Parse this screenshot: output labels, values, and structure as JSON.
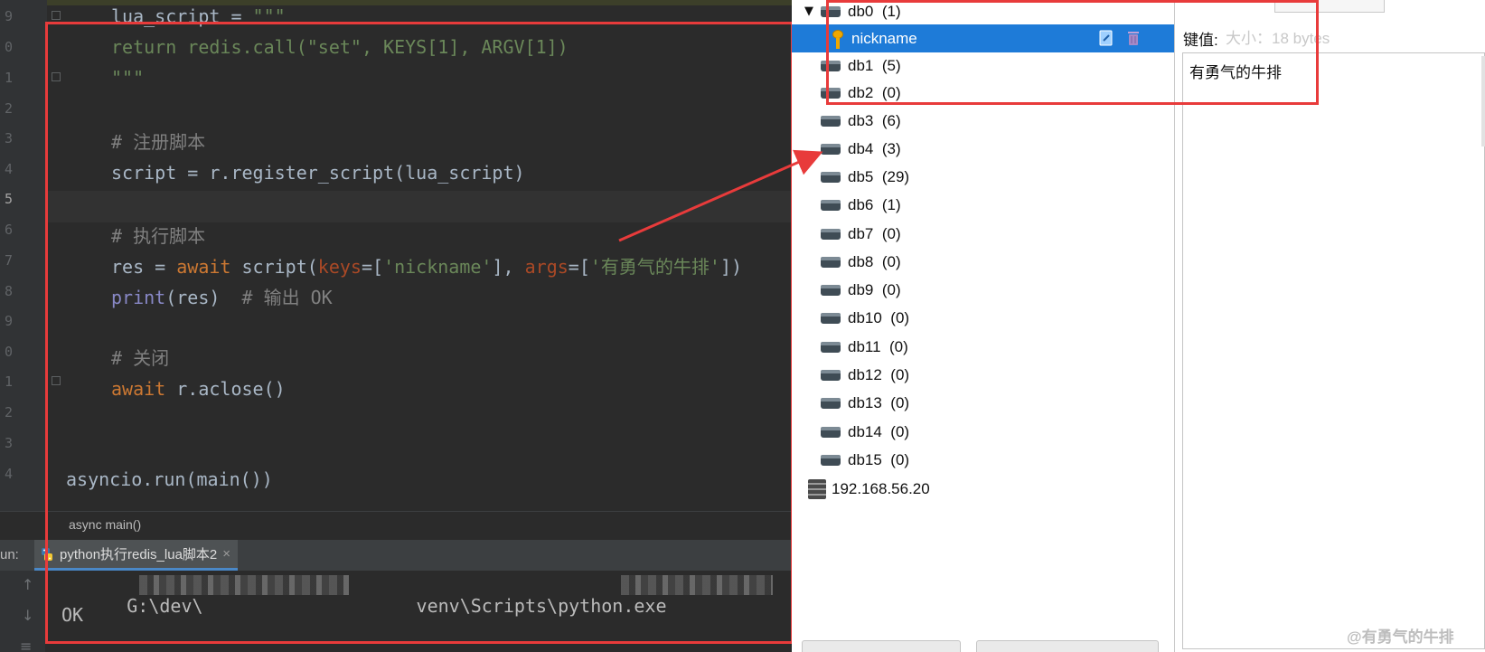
{
  "editor": {
    "line_numbers": [
      "9",
      "0",
      "1",
      "2",
      "3",
      "4",
      "5",
      "6",
      "7",
      "8",
      "9",
      "0",
      "1",
      "2",
      "3",
      "4"
    ],
    "code": {
      "l1_a": "lua_script = ",
      "l1_b": "\"\"\"",
      "l2": "return redis.call(\"set\", KEYS[1], ARGV[1])",
      "l3": "\"\"\"",
      "l5": "# 注册脚本",
      "l6": "script = r.register_script(lua_script)",
      "l8": "# 执行脚本",
      "l9_a": "res = ",
      "l9_b": "await",
      "l9_c": " script(",
      "l9_d": "keys",
      "l9_e": "=[",
      "l9_f": "'nickname'",
      "l9_g": "], ",
      "l9_h": "args",
      "l9_i": "=[",
      "l9_j": "'有勇气的牛排'",
      "l9_k": "])",
      "l10_a": "print",
      "l10_b": "(res)  ",
      "l10_c": "# 输出 OK",
      "l12": "# 关闭",
      "l13_a": "await",
      "l13_b": " r.aclose()",
      "l16": "asyncio.run(main())"
    },
    "breadcrumb": "async main()"
  },
  "run": {
    "label": "un:",
    "tab_label": "python执行redis_lua脚本2",
    "tab_close": "×",
    "console_line1_a": "G:\\dev\\",
    "console_line1_b": "venv\\Scripts\\python.exe",
    "console_line2": "OK"
  },
  "tree": {
    "expand_glyph": "▼",
    "databases": [
      {
        "name": "db0",
        "count": "(1)"
      },
      {
        "name": "db1",
        "count": "(5)"
      },
      {
        "name": "db2",
        "count": "(0)"
      },
      {
        "name": "db3",
        "count": "(6)"
      },
      {
        "name": "db4",
        "count": "(3)"
      },
      {
        "name": "db5",
        "count": "(29)"
      },
      {
        "name": "db6",
        "count": "(1)"
      },
      {
        "name": "db7",
        "count": "(0)"
      },
      {
        "name": "db8",
        "count": "(0)"
      },
      {
        "name": "db9",
        "count": "(0)"
      },
      {
        "name": "db10",
        "count": "(0)"
      },
      {
        "name": "db11",
        "count": "(0)"
      },
      {
        "name": "db12",
        "count": "(0)"
      },
      {
        "name": "db13",
        "count": "(0)"
      },
      {
        "name": "db14",
        "count": "(0)"
      },
      {
        "name": "db15",
        "count": "(0)"
      }
    ],
    "key": "nickname",
    "server": "192.168.56.20"
  },
  "value_panel": {
    "key_value_label": "键值:",
    "size_label": "大小：18 bytes",
    "value": "有勇气的牛排",
    "watermark": "@有勇气的牛排"
  },
  "colors": {
    "highlight_box": "#e83b3b",
    "selection": "#1e7bd8"
  }
}
